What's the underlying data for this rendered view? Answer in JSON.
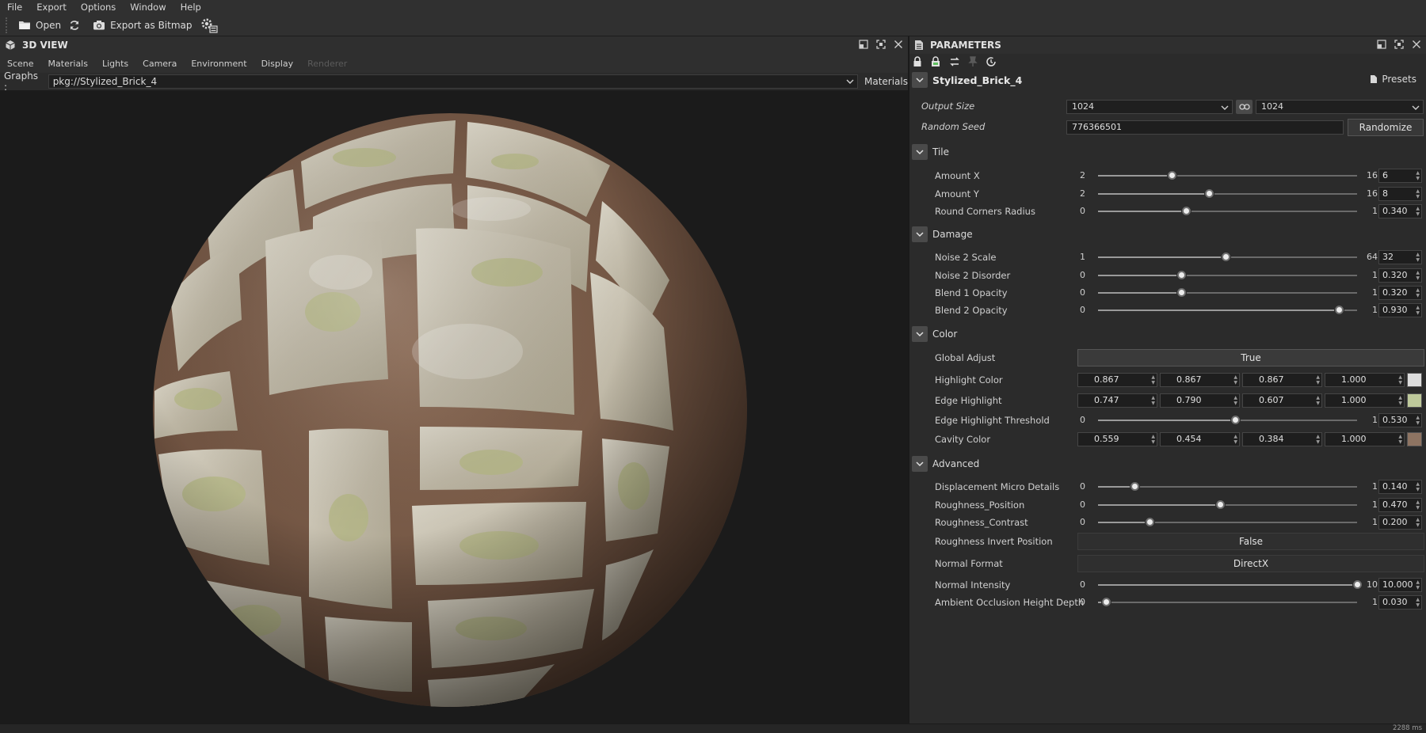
{
  "menu": [
    "File",
    "Export",
    "Options",
    "Window",
    "Help"
  ],
  "toolbar": {
    "open_label": "Open",
    "export_label": "Export as Bitmap",
    "icons": [
      "folder-icon",
      "refresh-icon",
      "camera-icon",
      "settings-gear-icon"
    ]
  },
  "view3d": {
    "title": "3D VIEW",
    "tabs": [
      "Scene",
      "Materials",
      "Lights",
      "Camera",
      "Environment",
      "Display",
      "Renderer"
    ],
    "graphs_label": "Graphs :",
    "graph_path": "pkg://Stylized_Brick_4",
    "materials_label": "Materials"
  },
  "params": {
    "title": "PARAMETERS",
    "material_name": "Stylized_Brick_4",
    "presets_label": "Presets",
    "output_size": {
      "label": "Output Size",
      "width": "1024",
      "height": "1024"
    },
    "random_seed": {
      "label": "Random Seed",
      "value": "776366501",
      "button": "Randomize"
    },
    "groups": {
      "tile": {
        "name": "Tile",
        "rows": [
          {
            "label": "Amount X",
            "min": "2",
            "max": "16",
            "value": "6",
            "fraction": 0.2857
          },
          {
            "label": "Amount Y",
            "min": "2",
            "max": "16",
            "value": "8",
            "fraction": 0.4286
          },
          {
            "label": "Round Corners Radius",
            "min": "0",
            "max": "1",
            "value": "0.340",
            "fraction": 0.34
          }
        ]
      },
      "damage": {
        "name": "Damage",
        "rows": [
          {
            "label": "Noise 2 Scale",
            "min": "1",
            "max": "64",
            "value": "32",
            "fraction": 0.492
          },
          {
            "label": "Noise 2 Disorder",
            "min": "0",
            "max": "1",
            "value": "0.320",
            "fraction": 0.32
          },
          {
            "label": "Blend 1 Opacity",
            "min": "0",
            "max": "1",
            "value": "0.320",
            "fraction": 0.32
          },
          {
            "label": "Blend 2 Opacity",
            "min": "0",
            "max": "1",
            "value": "0.930",
            "fraction": 0.93
          }
        ]
      },
      "color": {
        "name": "Color",
        "global_adjust": {
          "label": "Global Adjust",
          "value": "True"
        },
        "highlight_color": {
          "label": "Highlight Color",
          "values": [
            "0.867",
            "0.867",
            "0.867",
            "1.000"
          ],
          "swatch": "#dddddd"
        },
        "edge_highlight": {
          "label": "Edge Highlight",
          "values": [
            "0.747",
            "0.790",
            "0.607",
            "1.000"
          ],
          "swatch": "#bec99b"
        },
        "edge_threshold": {
          "label": "Edge Highlight Threshold",
          "min": "0",
          "max": "1",
          "value": "0.530",
          "fraction": 0.53
        },
        "cavity_color": {
          "label": "Cavity Color",
          "values": [
            "0.559",
            "0.454",
            "0.384",
            "1.000"
          ],
          "swatch": "#8e7462"
        }
      },
      "advanced": {
        "name": "Advanced",
        "rows": [
          {
            "label": "Displacement Micro Details",
            "min": "0",
            "max": "1",
            "value": "0.140",
            "fraction": 0.14
          },
          {
            "label": "Roughness_Position",
            "min": "0",
            "max": "1",
            "value": "0.470",
            "fraction": 0.47
          },
          {
            "label": "Roughness_Contrast",
            "min": "0",
            "max": "1",
            "value": "0.200",
            "fraction": 0.2
          }
        ],
        "invert": {
          "label": "Roughness Invert Position",
          "value": "False"
        },
        "normal_format": {
          "label": "Normal Format",
          "value": "DirectX"
        },
        "rows2": [
          {
            "label": "Normal Intensity",
            "min": "0",
            "max": "10",
            "value": "10.000",
            "fraction": 1.0
          },
          {
            "label": "Ambient Occlusion Height Depth",
            "min": "0",
            "max": "1",
            "value": "0.030",
            "fraction": 0.03
          }
        ]
      }
    }
  },
  "status": {
    "time": "2288 ms"
  },
  "colors": {
    "mortar": "#7d5f4c",
    "brick_light": "#c9c2b1",
    "moss": "#b7b88a"
  }
}
